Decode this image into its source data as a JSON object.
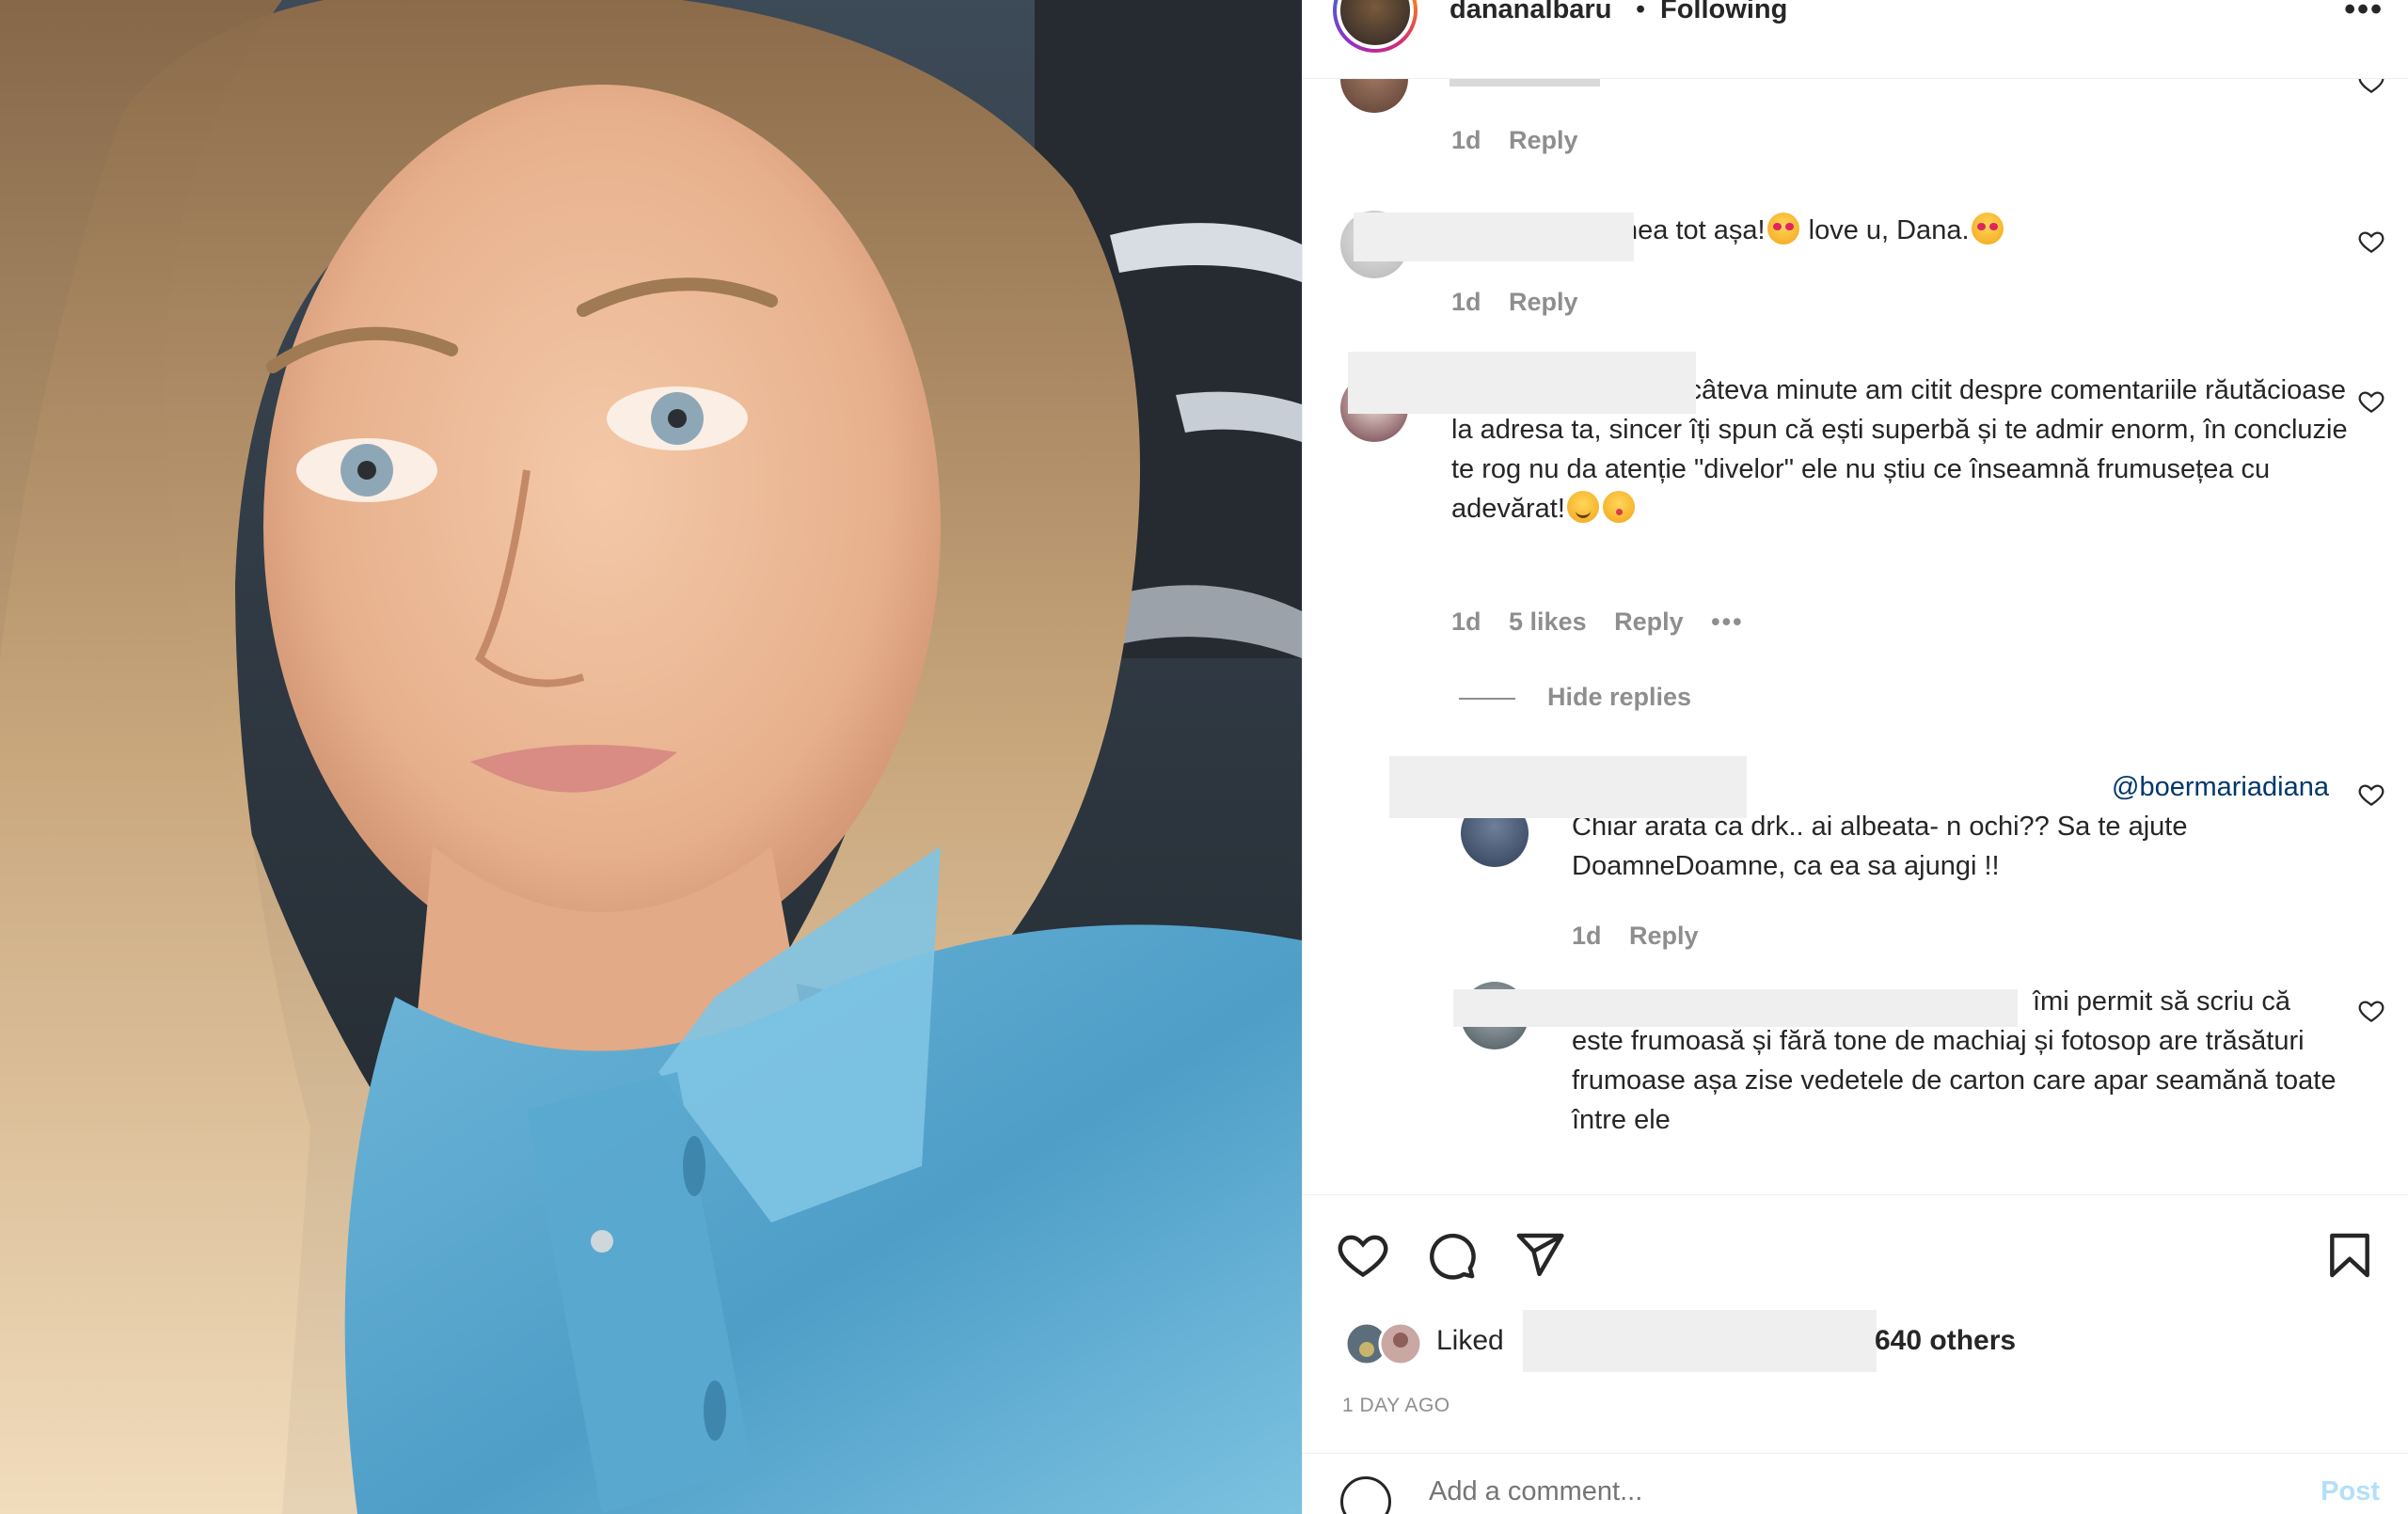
{
  "post": {
    "username": "dananalbaru",
    "separator": "•",
    "follow_status": "Following",
    "more": "•••",
    "image_alt": "selfie of a woman with blonde hair wearing a denim shirt"
  },
  "comments": [
    {
      "text": "",
      "time": "1d",
      "reply": "Reply"
    },
    {
      "text": "nea tot așa!",
      "text_tail": " love u, Dana.",
      "time": "1d",
      "reply": "Reply"
    },
    {
      "text": "Dragă Dana, acum câteva minute am citit despre comentariile răutăcioase la adresa ta, sincer îți spun că ești superbă și te admir enorm, în concluzie te rog nu da atenție \"divelor\" ele nu știu ce înseamnă frumusețea cu adevărat!",
      "time": "1d",
      "likes": "5 likes",
      "reply": "Reply",
      "more": "•••",
      "hide_replies": "Hide replies"
    }
  ],
  "replies": [
    {
      "mention": "@boermariadiana",
      "text": " Chiar arata ca drk.. ai albeata- n ochi?? Sa te ajute DoamneDoamne, ca ea sa ajungi !!",
      "time": "1d",
      "reply": "Reply"
    },
    {
      "text": "îmi permit să scriu că este frumoasă și fără tone de machiaj și fotosop are trăsături frumoase așa zise vedetele de carton care apar seamănă toate între ele"
    }
  ],
  "likes": {
    "prefix": "Liked",
    "suffix": "640 others"
  },
  "timestamp": "1 DAY AGO",
  "add_comment": {
    "placeholder": "Add a comment...",
    "post_label": "Post"
  },
  "icons": [
    "like-icon",
    "comment-icon",
    "share-icon",
    "save-icon",
    "emoji-icon",
    "heart-small-icon"
  ]
}
